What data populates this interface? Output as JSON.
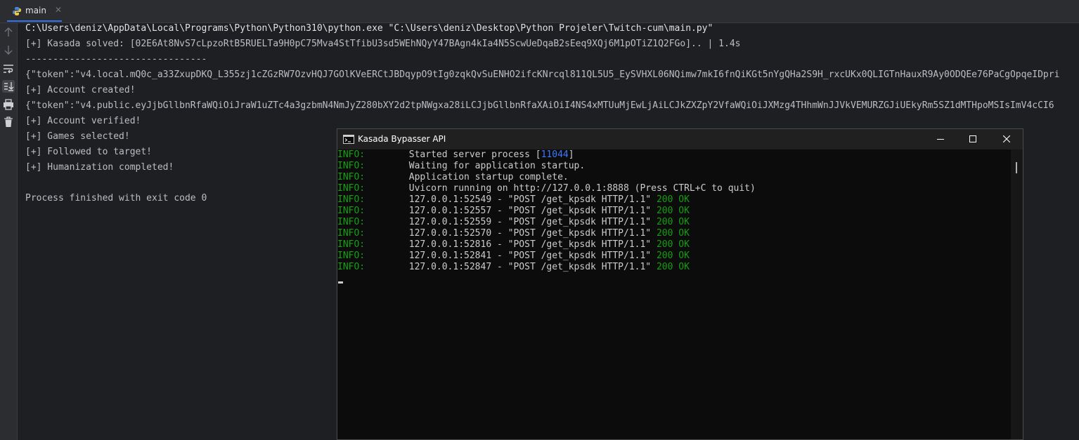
{
  "tab": {
    "label": "main",
    "close": "✕"
  },
  "gutter": {
    "icons": [
      "arrow-up-icon",
      "arrow-down-icon",
      "soft-wrap-icon",
      "scroll-to-end-icon",
      "print-icon",
      "trash-icon"
    ]
  },
  "console": {
    "lines": [
      "C:\\Users\\deniz\\AppData\\Local\\Programs\\Python\\Python310\\python.exe \"C:\\Users\\deniz\\Desktop\\Python Projeler\\Twitch-cum\\main.py\"",
      "[+] Kasada solved: [02E6At8NvS7cLpzoRtB5RUELTa9H0pC75Mva4StTfibU3sd5WEhNQyY47BAgn4kIa4N5ScwUeDqaB2sEeq9XQj6M1pOTiZ1Q2FGo].. | 1.4s",
      "---------------------------------",
      "{\"token\":\"v4.local.mQ0c_a33ZxupDKQ_L355zj1cZGzRW7OzvHQJ7GOlKVeERCtJBDqypO9tIg0zqkQvSuENHO2ifcKNrcql811QL5U5_EySVHXL06NQimw7mkI6fnQiKGt5nYgQHa2S9H_rxcUKx0QLIGTnHauxR9Ay0ODQEe76PaCgOpqeIDpri",
      "[+] Account created!",
      "{\"token\":\"v4.public.eyJjbGllbnRfaWQiOiJraW1uZTc4a3gzbmN4NmJyZ280bXY2d2tpNWgxa28iLCJjbGllbnRfaXAiOiI4NS4xMTUuMjEwLjAiLCJkZXZpY2VfaWQiOiJXMzg4THhmWnJJVkVEMURZGJiUEkyRm5SZ1dMTHpoMSIsImV4cCI6",
      "[+] Account verified!",
      "[+] Games selected!",
      "[+] Followed to target!",
      "[+] Humanization completed!",
      "",
      "Process finished with exit code 0"
    ]
  },
  "terminal": {
    "title": "Kasada Bypasser API",
    "controls": {
      "minimize": "minimize",
      "maximize": "maximize",
      "close": "close"
    },
    "lines": [
      {
        "level": "INFO:",
        "pre": "     Started server process [",
        "num": "11044",
        "post": "]",
        "status": ""
      },
      {
        "level": "INFO:",
        "pre": "     Waiting for application startup.",
        "num": "",
        "post": "",
        "status": ""
      },
      {
        "level": "INFO:",
        "pre": "     Application startup complete.",
        "num": "",
        "post": "",
        "status": ""
      },
      {
        "level": "INFO:",
        "pre": "     Uvicorn running on http://127.0.0.1:8888 (Press CTRL+C to quit)",
        "num": "",
        "post": "",
        "status": ""
      },
      {
        "level": "INFO:",
        "pre": "     127.0.0.1:52549 - \"POST /get_kpsdk HTTP/1.1\" ",
        "num": "",
        "post": "",
        "status": "200 OK"
      },
      {
        "level": "INFO:",
        "pre": "     127.0.0.1:52557 - \"POST /get_kpsdk HTTP/1.1\" ",
        "num": "",
        "post": "",
        "status": "200 OK"
      },
      {
        "level": "INFO:",
        "pre": "     127.0.0.1:52559 - \"POST /get_kpsdk HTTP/1.1\" ",
        "num": "",
        "post": "",
        "status": "200 OK"
      },
      {
        "level": "INFO:",
        "pre": "     127.0.0.1:52570 - \"POST /get_kpsdk HTTP/1.1\" ",
        "num": "",
        "post": "",
        "status": "200 OK"
      },
      {
        "level": "INFO:",
        "pre": "     127.0.0.1:52816 - \"POST /get_kpsdk HTTP/1.1\" ",
        "num": "",
        "post": "",
        "status": "200 OK"
      },
      {
        "level": "INFO:",
        "pre": "     127.0.0.1:52841 - \"POST /get_kpsdk HTTP/1.1\" ",
        "num": "",
        "post": "",
        "status": "200 OK"
      },
      {
        "level": "INFO:",
        "pre": "     127.0.0.1:52847 - \"POST /get_kpsdk HTTP/1.1\" ",
        "num": "",
        "post": "",
        "status": "200 OK"
      }
    ]
  },
  "colors": {
    "ide_bg": "#1e1f22",
    "tab_accent": "#3574f0",
    "terminal_bg": "#0c0c0c",
    "info_green": "#13a10e",
    "pid_blue": "#3b78ff"
  }
}
